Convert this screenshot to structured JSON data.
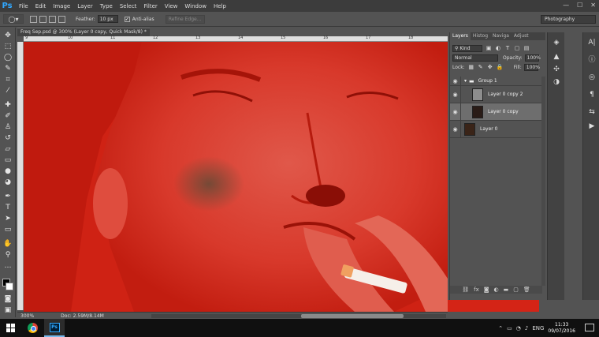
{
  "app": {
    "logo": "Ps"
  },
  "menu": [
    "File",
    "Edit",
    "Image",
    "Layer",
    "Type",
    "Select",
    "Filter",
    "View",
    "Window",
    "Help"
  ],
  "window_controls": {
    "minimize": "—",
    "maximize": "☐",
    "close": "✕"
  },
  "options": {
    "feather_label": "Feather:",
    "feather_value": "10 px",
    "antialias_label": "Anti-alias",
    "refine_label": "Refine Edge...",
    "workspace": "Photography"
  },
  "document": {
    "tab_title": "Freq Sep.psd @ 300% (Layer 0 copy, Quick Mask/8) *",
    "tab_close": "×",
    "ruler_numbers": [
      "9",
      "10",
      "11",
      "12",
      "13",
      "14",
      "15",
      "16",
      "17",
      "18"
    ],
    "zoom": "300%",
    "doc_size": "Doc: 2.59M/8.14M"
  },
  "layers_panel": {
    "tabs": [
      "Layers",
      "Histog",
      "Naviga",
      "Adjust"
    ],
    "kind_label": "Kind",
    "blend_mode": "Normal",
    "opacity_label": "Opacity:",
    "opacity_value": "100%",
    "lock_label": "Lock:",
    "fill_label": "Fill:",
    "fill_value": "100%",
    "layers": [
      {
        "name": "Group 1",
        "type": "group"
      },
      {
        "name": "Layer 0 copy 2",
        "type": "layer",
        "thumb_color": "#8d8d8d"
      },
      {
        "name": "Layer 0 copy",
        "type": "layer",
        "selected": true,
        "thumb_color": "#2a1c17"
      },
      {
        "name": "Layer 0",
        "type": "layer",
        "thumb_color": "#3a2418"
      }
    ],
    "footer_icons": [
      "link-icon",
      "fx-icon",
      "mask-icon",
      "adjustment-icon",
      "folder-icon",
      "new-layer-icon",
      "trash-icon"
    ]
  },
  "taskbar": {
    "language": "ENG",
    "time": "11:33",
    "date": "09/07/2016"
  },
  "colors": {
    "quick_mask_red": "#d42416",
    "ps_blue": "#31a8ff"
  }
}
